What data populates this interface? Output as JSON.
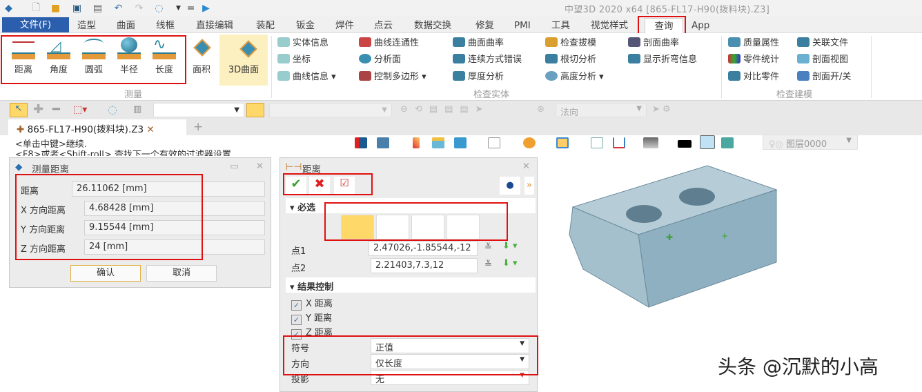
{
  "app_title": "中望3D 2020 x64   [865-FL17-H90(拨料块).Z3]",
  "quick_access": [
    "app-logo-icon",
    "new-file-icon",
    "open-file-icon",
    "save-icon",
    "print-icon",
    "undo-icon",
    "redo-icon",
    "rebuild-icon",
    "dropdown-icon",
    "customize-icon",
    "expand-icon"
  ],
  "menu": [
    "文件(F)",
    "造型",
    "曲面",
    "线框",
    "直接编辑",
    "装配",
    "钣金",
    "焊件",
    "点云",
    "数据交换",
    "修复",
    "PMI",
    "工具",
    "视觉样式",
    "查询",
    "App"
  ],
  "ribbon": {
    "measure_group": {
      "label": "测量",
      "items": [
        "距离",
        "角度",
        "圆弧",
        "半径",
        "长度"
      ]
    },
    "area": "面积",
    "surface3d": "3D曲面",
    "check_solid": {
      "label": "检查实体",
      "items": [
        "实体信息",
        "坐标",
        "曲线信息",
        "曲线连通性",
        "分析面",
        "控制多边形",
        "曲面曲率",
        "连续方式错误",
        "厚度分析",
        "检查拔模",
        "根切分析",
        "高度分析",
        "剖面曲率",
        "显示折弯信息"
      ]
    },
    "check_model": {
      "label": "检查建模",
      "items": [
        "质量属性",
        "零件统计",
        "对比零件",
        "关联文件",
        "剖面视图",
        "剖面开/关"
      ]
    }
  },
  "toolbar": {
    "filter_value": "",
    "direction": "法向"
  },
  "doc_tab": "865-FL17-H90(拨料块).Z3",
  "hints": [
    "<单击中键>继续.",
    "<F8>或者<Shift-roll> 查找下一个有效的过滤器设置"
  ],
  "layer": "图层0000",
  "measure_dialog": {
    "title": "测量距离",
    "rows": [
      {
        "label": "距离",
        "value": "26.11062  [mm]"
      },
      {
        "label": "X 方向距离",
        "value": "4.68428  [mm]"
      },
      {
        "label": "Y 方向距离",
        "value": "9.15544  [mm]"
      },
      {
        "label": "Z 方向距离",
        "value": "24  [mm]"
      }
    ],
    "ok": "确认",
    "cancel": "取消"
  },
  "distance_dialog": {
    "title": "距离",
    "required": "必选",
    "point1_label": "点1",
    "point1": "2.47026,-1.85544,-12",
    "point2_label": "点2",
    "point2": "2.21403,7.3,12",
    "result": "结果控制",
    "checks": [
      {
        "label": "X 距离",
        "checked": true
      },
      {
        "label": "Y 距离",
        "checked": true
      },
      {
        "label": "Z 距离",
        "checked": true
      }
    ],
    "sign_label": "符号",
    "sign": "正值",
    "direction_label": "方向",
    "direction": "仅长度",
    "projection_label": "投影",
    "projection": "无"
  },
  "watermark": "头条 @沉默的小高",
  "colors": {
    "file_menu": "#2b5fad",
    "highlight": "#e01010",
    "selected": "#ffd86a",
    "model": "#a9c3d0"
  }
}
